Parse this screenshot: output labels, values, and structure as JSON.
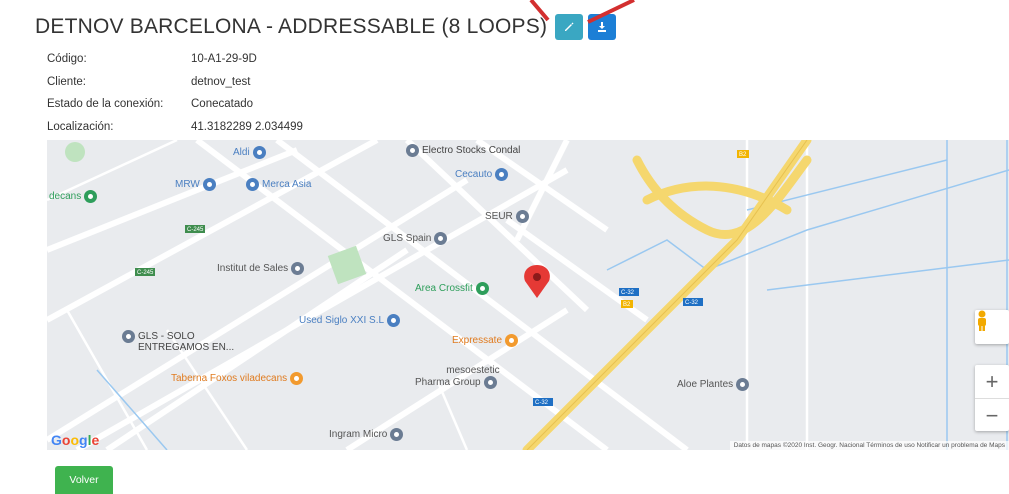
{
  "header": {
    "title": "DETNOV BARCELONA - ADDRESSABLE (8 LOOPS)",
    "edit_icon": "edit-icon",
    "download_icon": "download-icon"
  },
  "info": {
    "rows": [
      {
        "label": "Código:",
        "value": "10-A1-29-9D"
      },
      {
        "label": "Cliente:",
        "value": "detnov_test"
      },
      {
        "label": "Estado de la conexión:",
        "value": "Conecatado"
      },
      {
        "label": "Localización:",
        "value": "41.3182289 2.034499"
      }
    ]
  },
  "map": {
    "pois": [
      {
        "name": "Aldi"
      },
      {
        "name": "Electro Stocks Condal"
      },
      {
        "name": "MRW"
      },
      {
        "name": "Merca Asia"
      },
      {
        "name": "Cecauto"
      },
      {
        "name": "decans"
      },
      {
        "name": "SEUR"
      },
      {
        "name": "GLS Spain"
      },
      {
        "name": "Institut de Sales"
      },
      {
        "name": "Area Crossfit"
      },
      {
        "name": "Used Siglo XXI S.L"
      },
      {
        "name": "GLS - SOLO"
      },
      {
        "name": "ENTREGAMOS EN..."
      },
      {
        "name": "Expressate"
      },
      {
        "name": "Taberna Foxos viladecans"
      },
      {
        "name": "mesoestetic"
      },
      {
        "name": "Pharma Group"
      },
      {
        "name": "Aloe Plantes"
      },
      {
        "name": "Ingram Micro"
      }
    ],
    "road_labels": [
      "C-245",
      "C-245",
      "C-32",
      "C-32",
      "B2",
      "B2",
      "C-32"
    ],
    "zoom_in": "+",
    "zoom_out": "−",
    "footer": "Datos de mapas ©2020 Inst. Geogr. Nacional   Términos de uso   Notificar un problema de Maps",
    "google": "Google"
  },
  "actions": {
    "back": "Volver"
  },
  "colors": {
    "volver": "#3fb34f",
    "edit_btn": "#3aa7c2",
    "download_btn": "#1c7fd6",
    "marker": "#e53935",
    "highway": "#f5d76e"
  }
}
